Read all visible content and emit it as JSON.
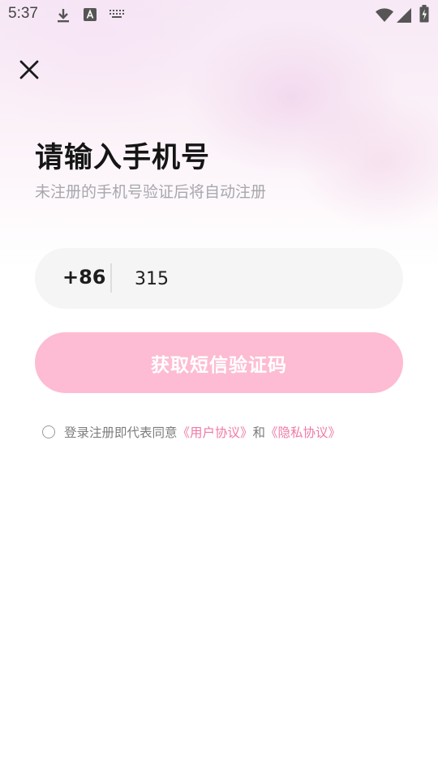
{
  "status_bar": {
    "time": "5:37",
    "icons": [
      "download-icon",
      "font-a-icon",
      "keyboard-icon",
      "wifi-icon",
      "signal-icon",
      "battery-charging-icon"
    ]
  },
  "title": "请输入手机号",
  "subtitle": "未注册的手机号验证后将自动注册",
  "phone": {
    "country_code": "+86",
    "value": "315"
  },
  "get_code_button": "获取短信验证码",
  "agreement": {
    "checked": false,
    "prefix": "登录注册即代表同意",
    "user_agreement": "《用户协议》",
    "conjunction": "和",
    "privacy_policy": "《隐私协议》"
  },
  "colors": {
    "accent_pink": "#ef79a6",
    "button_bg": "#fdbcd3",
    "input_bg": "#f5f5f5"
  }
}
